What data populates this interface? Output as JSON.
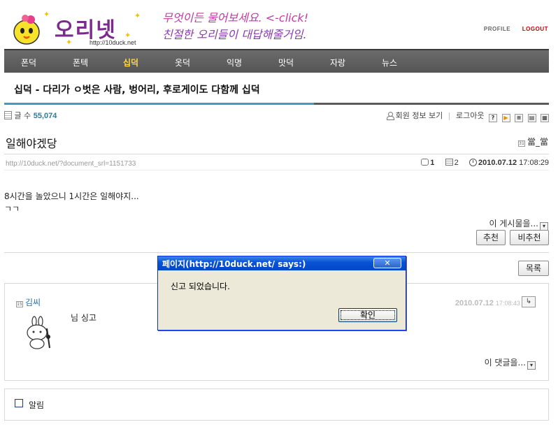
{
  "header": {
    "logo_text": "오리넷",
    "logo_url": "http://10duck.net",
    "slogan_line1": "무엇이든 물어보세요. <-click!",
    "slogan_line2": "친절한 오리들이 대답해줄거임.",
    "links": {
      "profile": "PROFILE",
      "logout": "LOGOUT"
    }
  },
  "nav": {
    "items": [
      {
        "label": "폰덕"
      },
      {
        "label": "폰텍"
      },
      {
        "label": "십덕",
        "active": true
      },
      {
        "label": "옷덕"
      },
      {
        "label": "익명"
      },
      {
        "label": "맛덕"
      },
      {
        "label": "자랑"
      },
      {
        "label": "뉴스"
      }
    ]
  },
  "board": {
    "title": "십덕 - 다리가 ㅇ벗은 사람, 벙어리, 후로게이도 다함께 십덕",
    "count_label": "글 수",
    "count_value": "55,074",
    "member_info": "회원 정보 보기",
    "logout": "로그아웃",
    "help_icon": "?"
  },
  "post": {
    "title": "일해야겠당",
    "author": "當_當",
    "url": "http://10duck.net/?document_srl=1151733",
    "comments": "1",
    "trackbacks": "2",
    "date": "2010.07.12",
    "time": "17:08:29",
    "body_line1": "8시간을 놀았으니 1시간은 일해야지...",
    "body_line2": "ㄱㄱ",
    "actions_label": "이 게시물을...",
    "recommend": "추천",
    "not_recommend": "비추천",
    "list": "목록"
  },
  "comment": {
    "author": "김씨",
    "date": "2010.07.12",
    "time": "17:08:43",
    "text": "님 싱고",
    "actions_label": "이 댓글을..."
  },
  "bottom": {
    "notify_label": "알림"
  },
  "dialog": {
    "title": "페이지(http://10duck.net/ says:)",
    "message": "신고 되었습니다.",
    "ok": "확인"
  }
}
